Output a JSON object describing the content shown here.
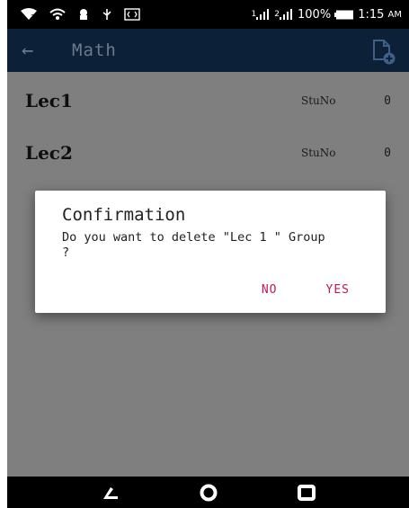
{
  "status_bar": {
    "battery_percent": "100%",
    "time": "1:15",
    "ampm": "AM",
    "sim1_label": "1",
    "sim2_label": "2"
  },
  "app_bar": {
    "title": "Math"
  },
  "list": {
    "items": [
      {
        "name": "Lec1",
        "label": "StuNo",
        "count": "0"
      },
      {
        "name": "Lec2",
        "label": "StuNo",
        "count": "0"
      }
    ]
  },
  "dialog": {
    "title": "Confirmation",
    "message": "Do you want to delete \"Lec 1 \" Group ?",
    "no_label": "NO",
    "yes_label": "YES"
  },
  "colors": {
    "app_bar": "#0c2037",
    "scrim": "#7f7f7f",
    "accent": "#c2185b"
  }
}
